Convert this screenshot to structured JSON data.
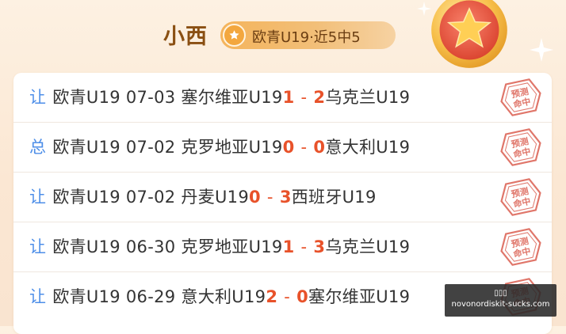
{
  "header": {
    "name": "小西",
    "badge_text": "欧青U19·近5中5",
    "badge_icon": "star-icon",
    "medal_icon": "star-medal-icon"
  },
  "rows": [
    {
      "tag": "让",
      "league": "欧青U19",
      "date": "07-03",
      "home": "塞尔维亚U19",
      "home_score": "1",
      "away_score": "2",
      "away": "乌克兰U19",
      "stamp": "预测命中"
    },
    {
      "tag": "总",
      "league": "欧青U19",
      "date": "07-02",
      "home": "克罗地亚U19",
      "home_score": "0",
      "away_score": "0",
      "away": "意大利U19",
      "stamp": "预测命中"
    },
    {
      "tag": "让",
      "league": "欧青U19",
      "date": "07-02",
      "home": "丹麦U19",
      "home_score": "0",
      "away_score": "3",
      "away": "西班牙U19",
      "stamp": "预测命中"
    },
    {
      "tag": "让",
      "league": "欧青U19",
      "date": "06-30",
      "home": "克罗地亚U19",
      "home_score": "1",
      "away_score": "3",
      "away": "乌克兰U19",
      "stamp": "预测命中"
    },
    {
      "tag": "让",
      "league": "欧青U19",
      "date": "06-29",
      "home": "意大利U19",
      "home_score": "2",
      "away_score": "0",
      "away": "塞尔维亚U19",
      "stamp": "预测命中"
    }
  ],
  "score_separator": "-",
  "watermark": {
    "line1": "▯▯▯",
    "line2": "novonordiskit-sucks.com"
  },
  "colors": {
    "tag": "#4d8ee8",
    "score": "#e8522a",
    "name": "#8a4f12",
    "stamp": "#e0766a"
  }
}
